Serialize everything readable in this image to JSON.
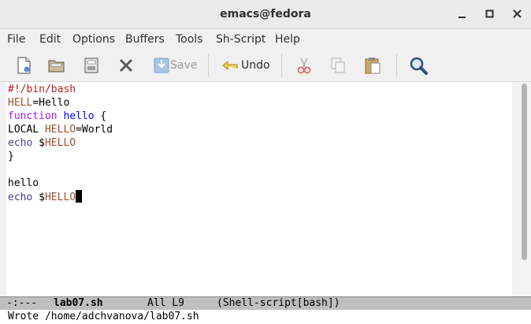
{
  "window": {
    "title": "emacs@fedora"
  },
  "menu": [
    "File",
    "Edit",
    "Options",
    "Buffers",
    "Tools",
    "Sh-Script",
    "Help"
  ],
  "toolbar": {
    "save_label": "Save",
    "undo_label": "Undo"
  },
  "editor": {
    "lines": [
      [
        {
          "t": "#!/bin/bash",
          "c": "comment"
        }
      ],
      [
        {
          "t": "HELL",
          "c": "var"
        },
        {
          "t": "=Hello",
          "c": "plain"
        }
      ],
      [
        {
          "t": "function",
          "c": "keyword"
        },
        {
          "t": " ",
          "c": "plain"
        },
        {
          "t": "hello",
          "c": "func"
        },
        {
          "t": " {",
          "c": "plain"
        }
      ],
      [
        {
          "t": "LOCAL ",
          "c": "plain"
        },
        {
          "t": "HELLO",
          "c": "var"
        },
        {
          "t": "=World",
          "c": "plain"
        }
      ],
      [
        {
          "t": "echo",
          "c": "builtin"
        },
        {
          "t": " $",
          "c": "plain"
        },
        {
          "t": "HELLO",
          "c": "var"
        }
      ],
      [
        {
          "t": "}",
          "c": "plain"
        }
      ],
      [],
      [
        {
          "t": "hello",
          "c": "plain"
        }
      ],
      [
        {
          "t": "echo",
          "c": "builtin"
        },
        {
          "t": " $",
          "c": "plain"
        },
        {
          "t": "HELLO",
          "c": "var"
        }
      ]
    ]
  },
  "modeline": {
    "status": "-:---",
    "buffer": "lab07.sh",
    "position": "All L9",
    "mode": "(Shell-script[bash])"
  },
  "minibuffer": {
    "message": "Wrote /home/adchvanova/lab07.sh"
  },
  "colors": {
    "comment": "#b22222",
    "keyword": "#a020f0",
    "func": "#0000ff",
    "var": "#a0522d",
    "builtin": "#483d8b",
    "plain": "#000000"
  }
}
